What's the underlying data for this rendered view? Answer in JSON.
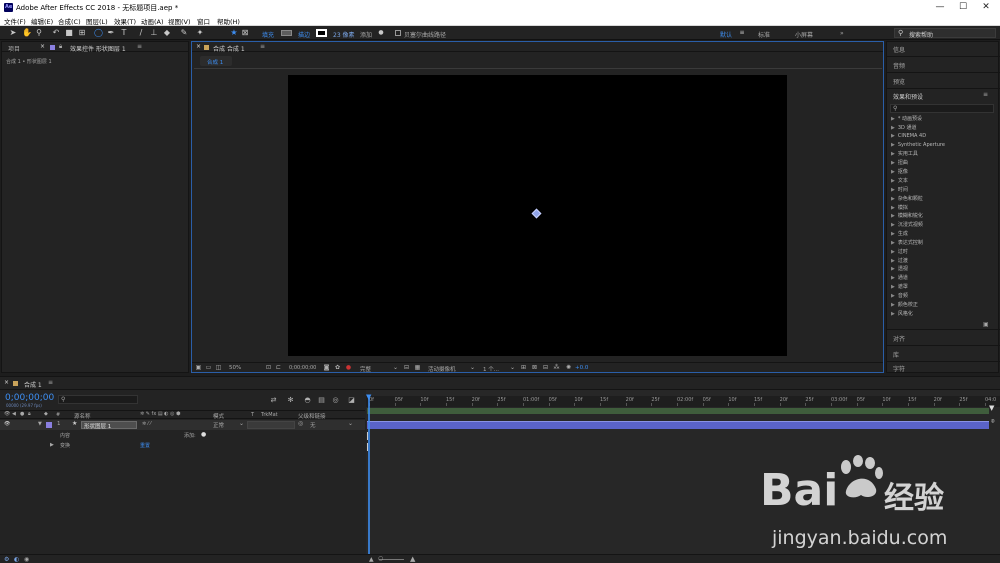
{
  "window": {
    "title": "Adobe After Effects CC 2018 - 无标题项目.aep *",
    "logo_text": "Ae"
  },
  "menus": [
    "文件(F)",
    "编辑(E)",
    "合成(C)",
    "图层(L)",
    "效果(T)",
    "动画(A)",
    "视图(V)",
    "窗口",
    "帮助(H)"
  ],
  "toolbar": {
    "fill_label": "填充",
    "stroke_label": "描边",
    "stroke_width": "23 像素",
    "add_label": "添加",
    "bezier_label": "贝塞尔曲线路径",
    "workspaces": [
      "默认",
      "标准",
      "小屏幕"
    ],
    "more": "»",
    "search_placeholder": "搜索帮助"
  },
  "project_panel": {
    "tabs": [
      "项目",
      "效果控件 形状图层 1"
    ],
    "breadcrumb": "合成 1 • 形状图层 1"
  },
  "comp_panel": {
    "tab": "合成 合成 1",
    "flow_tab": "合成 1",
    "viewer_bottom": {
      "zoom": "50%",
      "timecode": "0;00;00;00",
      "resolution": "完整",
      "camera": "活动摄像机",
      "views": "1 个...",
      "exposure": "+0.0"
    }
  },
  "right_panel": {
    "sections_top": [
      "信息",
      "音频",
      "预览"
    ],
    "effects_title": "效果和预设",
    "effects": [
      "* 动画预设",
      "3D 通道",
      "CINEMA 4D",
      "Synthetic Aperture",
      "实用工具",
      "扭曲",
      "抠像",
      "文本",
      "时间",
      "杂色和颗粒",
      "模拟",
      "模糊和锐化",
      "沉浸式视频",
      "生成",
      "表达式控制",
      "过时",
      "过渡",
      "透视",
      "通道",
      "遮罩",
      "音频",
      "颜色校正",
      "风格化"
    ],
    "sections_bottom": [
      "对齐",
      "库",
      "字符"
    ]
  },
  "timeline": {
    "tab": "合成 1",
    "timecode": "0;00;00;00",
    "fps": "00000 (29.97 fps)",
    "columns": {
      "num": "#",
      "name": "源名称",
      "mode": "模式",
      "t": "T",
      "trkmat": "TrkMat",
      "parent": "父级和链接"
    },
    "layer": {
      "index": "1",
      "name": "形状图层 1",
      "mode": "正常",
      "parent": "无"
    },
    "sub_contents": "内容",
    "sub_add": "添加:",
    "sub_transform": "变换",
    "sub_reset": "重置",
    "ruler": [
      "0f",
      "05f",
      "10f",
      "15f",
      "20f",
      "25f",
      "01:00f",
      "05f",
      "10f",
      "15f",
      "20f",
      "25f",
      "02:00f",
      "05f",
      "10f",
      "15f",
      "20f",
      "25f",
      "03:00f",
      "05f",
      "10f",
      "15f",
      "20f",
      "25f",
      "04:0"
    ]
  },
  "watermark": {
    "brand": "Bai",
    "brand_cn": "经验",
    "url": "jingyan.baidu.com"
  },
  "colors": {
    "accent": "#3d8ef2",
    "layer_bar": "#5a63c9",
    "work_area": "#3f5d3c",
    "label_purple": "#8a7fe0"
  }
}
